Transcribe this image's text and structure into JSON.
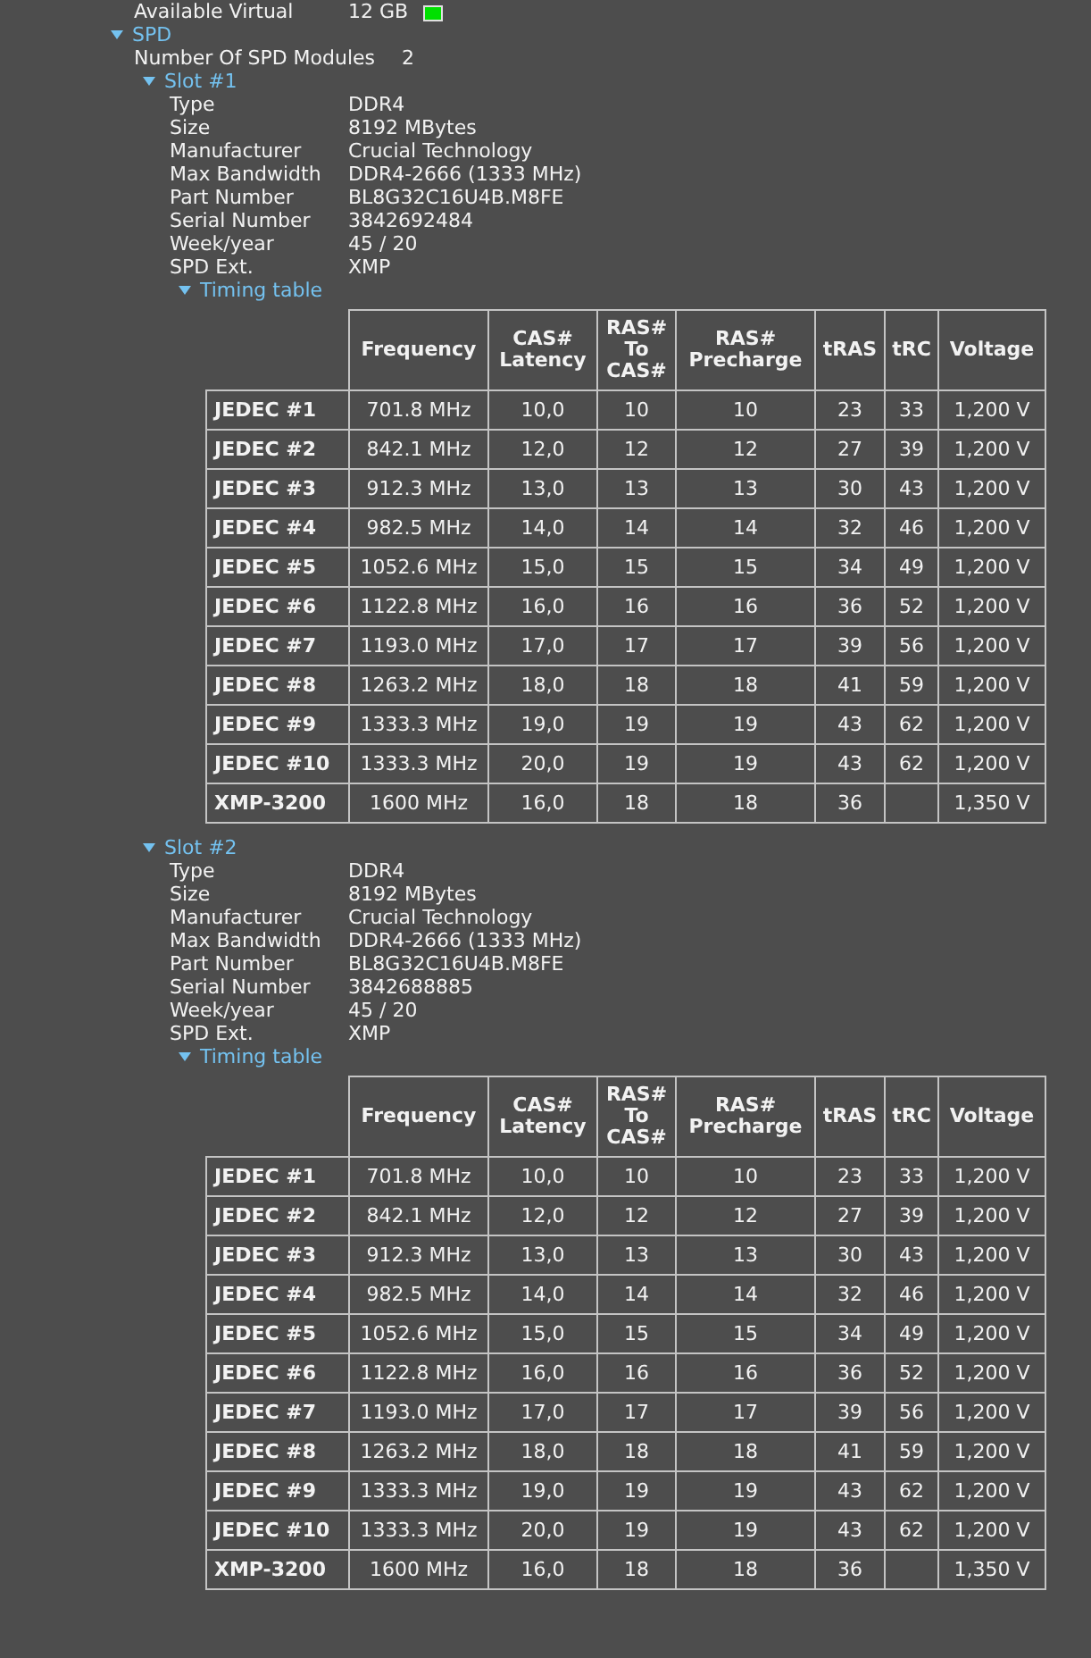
{
  "top_row": {
    "label": "Available Virtual",
    "value": "12 GB"
  },
  "spd": {
    "label": "SPD",
    "expanded": true,
    "fields": [
      {
        "label": "Number Of SPD Modules",
        "value": "2"
      }
    ],
    "slots": [
      {
        "label": "Slot #1",
        "expanded": true,
        "properties": [
          {
            "label": "Type",
            "value": "DDR4"
          },
          {
            "label": "Size",
            "value": "8192 MBytes"
          },
          {
            "label": "Manufacturer",
            "value": "Crucial Technology"
          },
          {
            "label": "Max Bandwidth",
            "value": "DDR4-2666 (1333 MHz)"
          },
          {
            "label": "Part Number",
            "value": "BL8G32C16U4B.M8FE"
          },
          {
            "label": "Serial Number",
            "value": "3842692484"
          },
          {
            "label": "Week/year",
            "value": "45 / 20"
          },
          {
            "label": "SPD Ext.",
            "value": "XMP"
          }
        ],
        "timing": {
          "label": "Timing table",
          "expanded": true,
          "columns": [
            "Frequency",
            "CAS#\nLatency",
            "RAS#\nTo\nCAS#",
            "RAS#\nPrecharge",
            "tRAS",
            "tRC",
            "Voltage"
          ],
          "rows": [
            {
              "name": "JEDEC #1",
              "cells": [
                "701.8 MHz",
                "10,0",
                "10",
                "10",
                "23",
                "33",
                "1,200 V"
              ]
            },
            {
              "name": "JEDEC #2",
              "cells": [
                "842.1 MHz",
                "12,0",
                "12",
                "12",
                "27",
                "39",
                "1,200 V"
              ]
            },
            {
              "name": "JEDEC #3",
              "cells": [
                "912.3 MHz",
                "13,0",
                "13",
                "13",
                "30",
                "43",
                "1,200 V"
              ]
            },
            {
              "name": "JEDEC #4",
              "cells": [
                "982.5 MHz",
                "14,0",
                "14",
                "14",
                "32",
                "46",
                "1,200 V"
              ]
            },
            {
              "name": "JEDEC #5",
              "cells": [
                "1052.6 MHz",
                "15,0",
                "15",
                "15",
                "34",
                "49",
                "1,200 V"
              ]
            },
            {
              "name": "JEDEC #6",
              "cells": [
                "1122.8 MHz",
                "16,0",
                "16",
                "16",
                "36",
                "52",
                "1,200 V"
              ]
            },
            {
              "name": "JEDEC #7",
              "cells": [
                "1193.0 MHz",
                "17,0",
                "17",
                "17",
                "39",
                "56",
                "1,200 V"
              ]
            },
            {
              "name": "JEDEC #8",
              "cells": [
                "1263.2 MHz",
                "18,0",
                "18",
                "18",
                "41",
                "59",
                "1,200 V"
              ]
            },
            {
              "name": "JEDEC #9",
              "cells": [
                "1333.3 MHz",
                "19,0",
                "19",
                "19",
                "43",
                "62",
                "1,200 V"
              ]
            },
            {
              "name": "JEDEC #10",
              "cells": [
                "1333.3 MHz",
                "20,0",
                "19",
                "19",
                "43",
                "62",
                "1,200 V"
              ]
            },
            {
              "name": "XMP-3200",
              "cells": [
                "1600 MHz",
                "16,0",
                "18",
                "18",
                "36",
                null,
                "1,350 V"
              ]
            }
          ]
        }
      },
      {
        "label": "Slot #2",
        "expanded": true,
        "properties": [
          {
            "label": "Type",
            "value": "DDR4"
          },
          {
            "label": "Size",
            "value": "8192 MBytes"
          },
          {
            "label": "Manufacturer",
            "value": "Crucial Technology"
          },
          {
            "label": "Max Bandwidth",
            "value": "DDR4-2666 (1333 MHz)"
          },
          {
            "label": "Part Number",
            "value": "BL8G32C16U4B.M8FE"
          },
          {
            "label": "Serial Number",
            "value": "3842688885"
          },
          {
            "label": "Week/year",
            "value": "45 / 20"
          },
          {
            "label": "SPD Ext.",
            "value": "XMP"
          }
        ],
        "timing": {
          "label": "Timing table",
          "expanded": true,
          "columns": [
            "Frequency",
            "CAS#\nLatency",
            "RAS#\nTo\nCAS#",
            "RAS#\nPrecharge",
            "tRAS",
            "tRC",
            "Voltage"
          ],
          "rows": [
            {
              "name": "JEDEC #1",
              "cells": [
                "701.8 MHz",
                "10,0",
                "10",
                "10",
                "23",
                "33",
                "1,200 V"
              ]
            },
            {
              "name": "JEDEC #2",
              "cells": [
                "842.1 MHz",
                "12,0",
                "12",
                "12",
                "27",
                "39",
                "1,200 V"
              ]
            },
            {
              "name": "JEDEC #3",
              "cells": [
                "912.3 MHz",
                "13,0",
                "13",
                "13",
                "30",
                "43",
                "1,200 V"
              ]
            },
            {
              "name": "JEDEC #4",
              "cells": [
                "982.5 MHz",
                "14,0",
                "14",
                "14",
                "32",
                "46",
                "1,200 V"
              ]
            },
            {
              "name": "JEDEC #5",
              "cells": [
                "1052.6 MHz",
                "15,0",
                "15",
                "15",
                "34",
                "49",
                "1,200 V"
              ]
            },
            {
              "name": "JEDEC #6",
              "cells": [
                "1122.8 MHz",
                "16,0",
                "16",
                "16",
                "36",
                "52",
                "1,200 V"
              ]
            },
            {
              "name": "JEDEC #7",
              "cells": [
                "1193.0 MHz",
                "17,0",
                "17",
                "17",
                "39",
                "56",
                "1,200 V"
              ]
            },
            {
              "name": "JEDEC #8",
              "cells": [
                "1263.2 MHz",
                "18,0",
                "18",
                "18",
                "41",
                "59",
                "1,200 V"
              ]
            },
            {
              "name": "JEDEC #9",
              "cells": [
                "1333.3 MHz",
                "19,0",
                "19",
                "19",
                "43",
                "62",
                "1,200 V"
              ]
            },
            {
              "name": "JEDEC #10",
              "cells": [
                "1333.3 MHz",
                "20,0",
                "19",
                "19",
                "43",
                "62",
                "1,200 V"
              ]
            },
            {
              "name": "XMP-3200",
              "cells": [
                "1600 MHz",
                "16,0",
                "18",
                "18",
                "36",
                null,
                "1,350 V"
              ]
            }
          ]
        }
      }
    ]
  }
}
